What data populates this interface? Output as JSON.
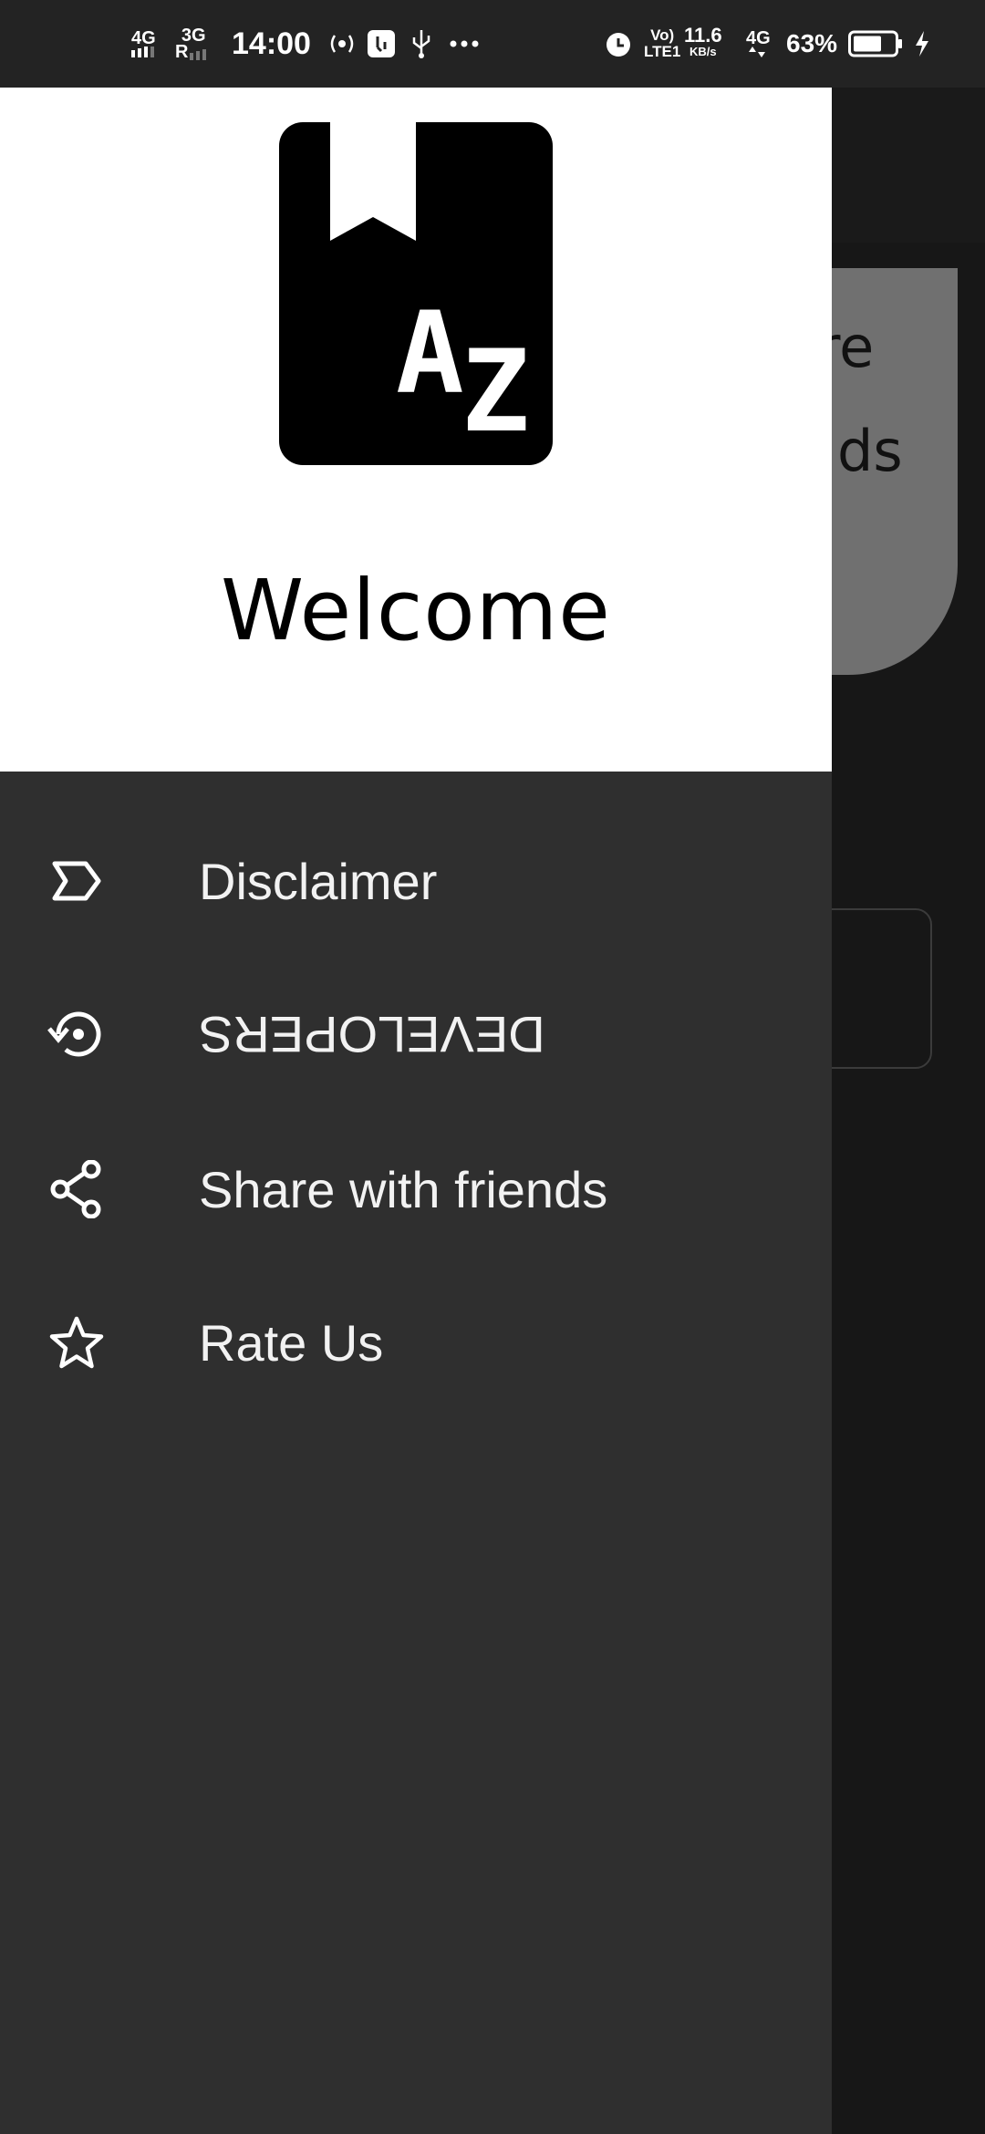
{
  "status_bar": {
    "net1": "4G",
    "net2": "3G",
    "net2_sub": "R",
    "time": "14:00",
    "volte": "Vo)",
    "volte_sub": "LTE1",
    "speed": "11.6",
    "speed_unit": "KB/s",
    "net3": "4G",
    "battery": "63%"
  },
  "background": {
    "card_text_1": "re",
    "card_text_2": "ds"
  },
  "drawer": {
    "header": {
      "logo_letters": "AZ",
      "welcome": "Welcome"
    },
    "items": [
      {
        "label": "Disclaimer",
        "icon": "label-icon"
      },
      {
        "label": "DEVELOPERS",
        "icon": "restore-icon"
      },
      {
        "label": "Share with friends",
        "icon": "share-icon"
      },
      {
        "label": "Rate Us",
        "icon": "star-icon"
      }
    ]
  },
  "colors": {
    "drawer_bg": "#2f2f2f",
    "header_bg": "#ffffff",
    "scrim": "#171717"
  }
}
